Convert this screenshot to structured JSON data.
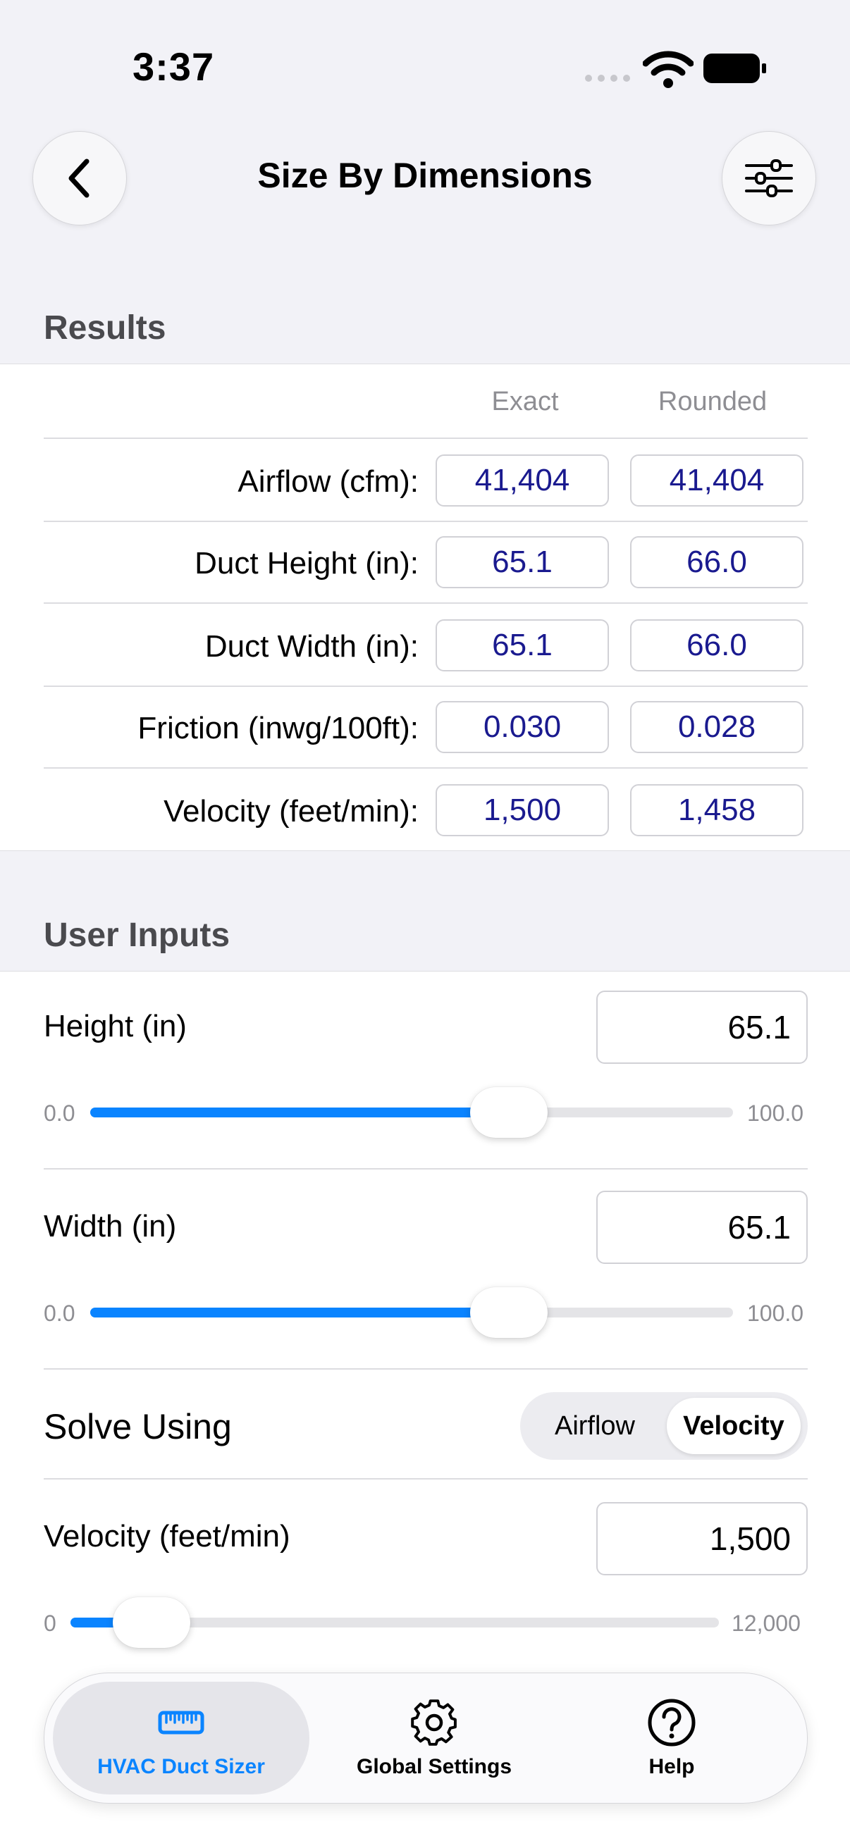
{
  "status_bar": {
    "time": "3:37"
  },
  "nav": {
    "title": "Size By Dimensions"
  },
  "results": {
    "section_title": "Results",
    "col_exact": "Exact",
    "col_rounded": "Rounded",
    "rows": [
      {
        "label": "Airflow (cfm):",
        "exact": "41,404",
        "rounded": "41,404"
      },
      {
        "label": "Duct Height (in):",
        "exact": "65.1",
        "rounded": "66.0"
      },
      {
        "label": "Duct Width (in):",
        "exact": "65.1",
        "rounded": "66.0"
      },
      {
        "label": "Friction (inwg/100ft):",
        "exact": "0.030",
        "rounded": "0.028"
      },
      {
        "label": "Velocity (feet/min):",
        "exact": "1,500",
        "rounded": "1,458"
      }
    ]
  },
  "inputs": {
    "section_title": "User Inputs",
    "height": {
      "label": "Height (in)",
      "value": "65.1",
      "min": "0.0",
      "max": "100.0",
      "fraction": 0.651
    },
    "width": {
      "label": "Width (in)",
      "value": "65.1",
      "min": "0.0",
      "max": "100.0",
      "fraction": 0.651
    },
    "solve": {
      "label": "Solve Using",
      "options": [
        "Airflow",
        "Velocity"
      ],
      "selected": "Velocity"
    },
    "velocity": {
      "label": "Velocity (feet/min)",
      "value": "1,500",
      "min": "0",
      "max": "12,000",
      "fraction": 0.125
    }
  },
  "tabbar": {
    "tabs": [
      {
        "label": "HVAC Duct Sizer",
        "icon": "ruler-icon",
        "selected": true
      },
      {
        "label": "Global Settings",
        "icon": "gear-icon",
        "selected": false
      },
      {
        "label": "Help",
        "icon": "question-circle-icon",
        "selected": false
      }
    ]
  },
  "colors": {
    "accent": "#0a84ff",
    "value_text": "#1a1a8f"
  }
}
